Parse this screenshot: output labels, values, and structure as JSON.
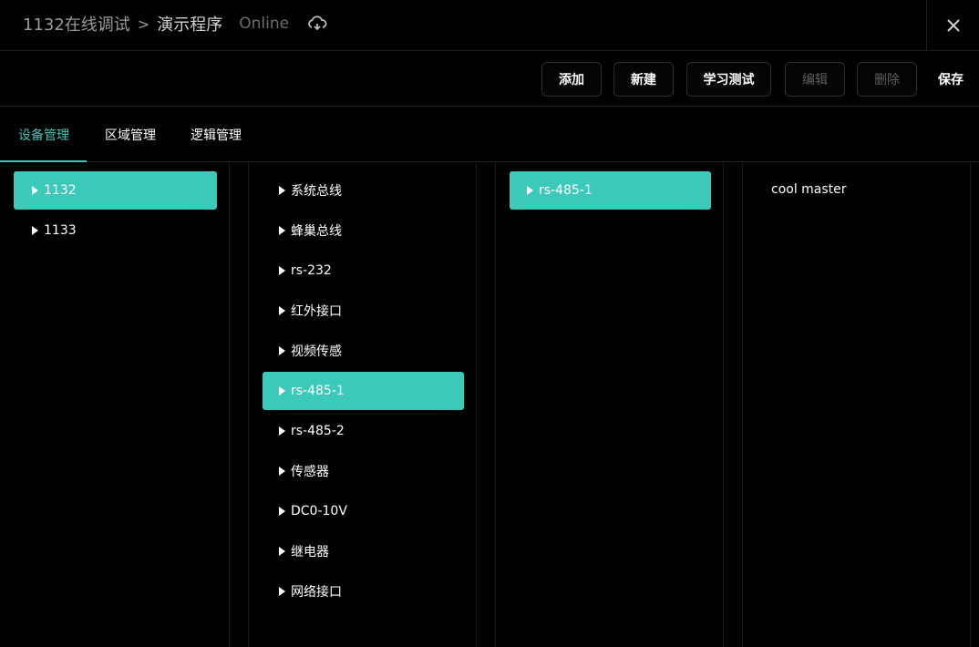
{
  "header": {
    "breadcrumb_root": "1132在线调试",
    "separator": ">",
    "breadcrumb_current": "演示程序",
    "status": "Online",
    "cloud_icon": "cloud-sync-icon",
    "close_icon": "close-icon"
  },
  "toolbar": {
    "add_label": "添加",
    "new_label": "新建",
    "learn_test_label": "学习测试",
    "edit_label": "编辑",
    "delete_label": "删除",
    "save_label": "保存"
  },
  "tabs": [
    {
      "label": "设备管理",
      "active": true
    },
    {
      "label": "区域管理",
      "active": false
    },
    {
      "label": "逻辑管理",
      "active": false
    }
  ],
  "devices": [
    {
      "label": "1132",
      "selected": true
    },
    {
      "label": "1133",
      "selected": false
    }
  ],
  "interfaces": [
    {
      "label": "系统总线",
      "selected": false
    },
    {
      "label": "蜂巢总线",
      "selected": false
    },
    {
      "label": "rs-232",
      "selected": false
    },
    {
      "label": "红外接口",
      "selected": false
    },
    {
      "label": "视频传感",
      "selected": false
    },
    {
      "label": "rs-485-1",
      "selected": true
    },
    {
      "label": "rs-485-2",
      "selected": false
    },
    {
      "label": "传感器",
      "selected": false
    },
    {
      "label": "DC0-10V",
      "selected": false
    },
    {
      "label": "继电器",
      "selected": false
    },
    {
      "label": "网络接口",
      "selected": false
    }
  ],
  "channels": [
    {
      "label": "rs-485-1",
      "selected": true
    }
  ],
  "drivers": [
    {
      "label": "cool master"
    }
  ],
  "colors": {
    "accent": "#3cc9b9",
    "background": "#000000",
    "border": "#1f1f1f"
  }
}
